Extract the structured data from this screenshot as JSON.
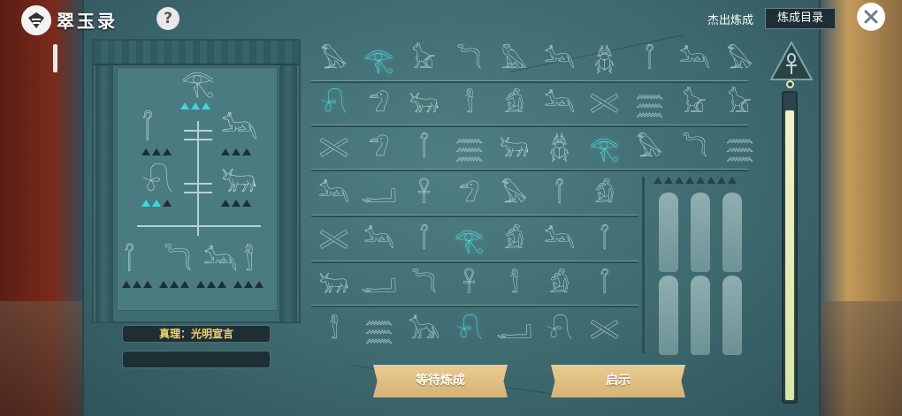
{
  "header": {
    "title": "翠玉录",
    "help_label": "?",
    "excellent_label": "杰出炼成",
    "catalog_label": "炼成目录"
  },
  "left_panel": {
    "truth_label": "真理：光明宣言",
    "second_field": ""
  },
  "buttons": {
    "wait_label": "等待炼成",
    "hint_label": "启示"
  },
  "grid": {
    "rows": [
      [
        "𓅃",
        "𓂀",
        "𓃠",
        "𓆓",
        "𓅓",
        "𓃢",
        "𓆣",
        "𓋾",
        "𓃢",
        "𓅃"
      ],
      [
        "𓍯",
        "𓅿",
        "𓃒",
        "𓀾",
        "𓀁",
        "𓃢",
        "𓏵",
        "𓈗",
        "𓃠",
        "𓃠"
      ],
      [
        "𓏵",
        "𓅿",
        "𓋾",
        "𓈗",
        "𓃒",
        "𓆣",
        "𓂀",
        "𓅃",
        "𓆓",
        "𓈗"
      ],
      [
        "𓃢",
        "𓂝",
        "𓋹",
        "𓅿",
        "𓅃",
        "𓋾",
        "𓀁"
      ],
      [
        "𓏵",
        "𓃢",
        "𓋾",
        "𓂀",
        "𓀁",
        "𓃢",
        "𓋾"
      ],
      [
        "𓃒",
        "𓂝",
        "𓆓",
        "𓋹",
        "𓀾",
        "𓀁",
        "𓋾"
      ],
      [
        "𓀾",
        "𓈗",
        "𓃥",
        "𓍯",
        "𓂝",
        "𓍯",
        "𓏵"
      ]
    ],
    "lit": [
      [
        0,
        1
      ],
      [
        1,
        0
      ],
      [
        2,
        6
      ],
      [
        4,
        3
      ],
      [
        6,
        3
      ]
    ]
  },
  "tree": {
    "top": "𓂀",
    "left2": "𓋾",
    "right2": "𓃢",
    "left3": "𓍯",
    "right3": "𓃒",
    "bottom": [
      "𓋾",
      "𓆓",
      "𓃢",
      "𓀾"
    ]
  },
  "progress_fraction": 0.95,
  "colors": {
    "accent": "#55e3e6",
    "gold": "#f3d46c",
    "button": "#dfbd80"
  },
  "icons": {
    "logo": "logo-icon",
    "close": "close-icon",
    "ankh": "ankh-icon"
  }
}
